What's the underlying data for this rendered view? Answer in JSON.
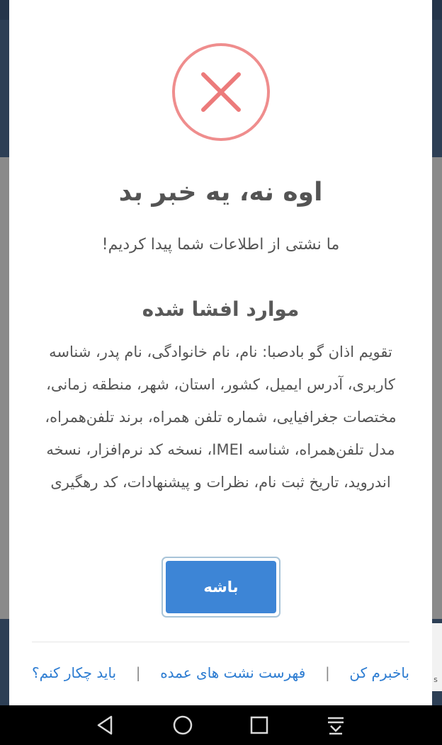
{
  "dialog": {
    "title": "اوه نه، یه خبر بد",
    "subtitle": "ما نشتی از اطلاعات شما پیدا کردیم!",
    "section_title": "موارد افشا شده",
    "description": "تقویم اذان گو بادصبا: نام، نام خانوادگی، نام پدر، شناسه کاربری، آدرس ایمیل، کشور، استان، شهر، منطقه زمانی، مختصات جغرافیایی، شماره تلفن همراه، برند تلفن‌همراه، مدل تلفن‌همراه، شناسه IMEI، نسخه کد نرم‌افزار، نسخه اندروید، تاریخ ثبت نام، نظرات و پیشنهادات، کد رهگیری",
    "ok_label": "باشه",
    "icon": "error-x-circle-icon",
    "accent_color": "#e97a7a",
    "button_color": "#3d85d6"
  },
  "footer": {
    "notify_label": "باخبرم کن",
    "breach_list_label": "فهرست نشت های عمده",
    "what_to_do_label": "باید چکار کنم؟",
    "separator": "|"
  },
  "background": {
    "side_text": "s"
  },
  "navbar": {
    "icons": [
      "back-icon",
      "home-icon",
      "recents-icon",
      "notifications-icon"
    ]
  }
}
